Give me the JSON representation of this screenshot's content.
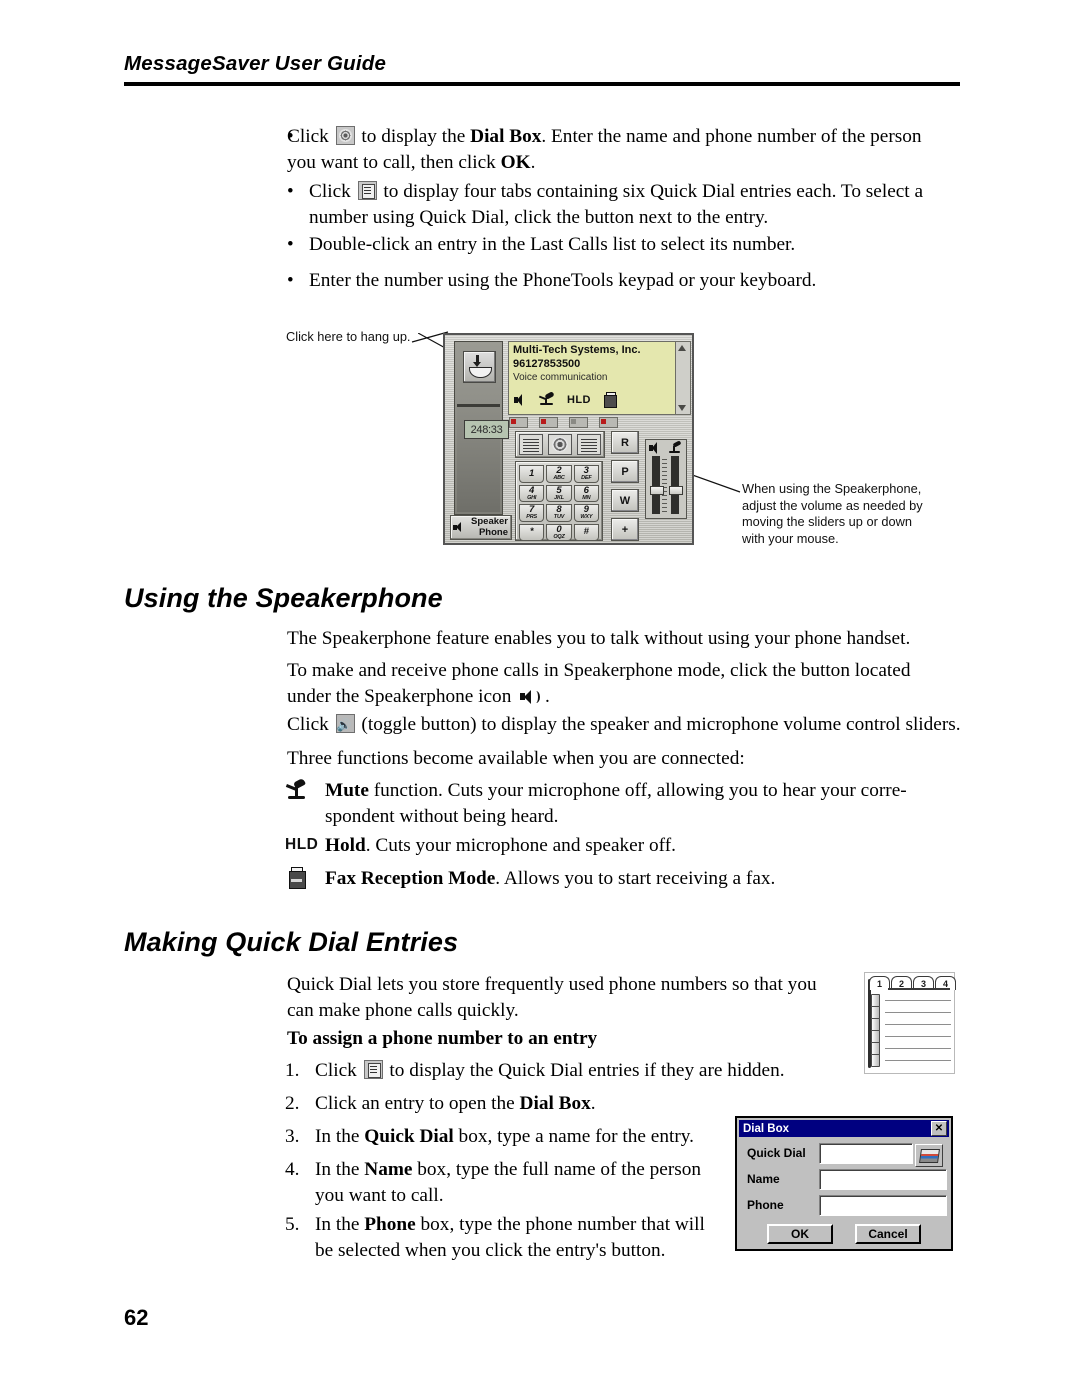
{
  "document": {
    "running_head": "MessageSaver User Guide",
    "page_number": "62"
  },
  "intro_bullets": [
    {
      "icon": "dial-box-icon",
      "segments": [
        {
          "t": "Click ",
          "b": false
        },
        {
          "t": "ICON",
          "b": false
        },
        {
          "t": " to display the ",
          "b": false
        },
        {
          "t": "Dial Box",
          "b": true
        },
        {
          "t": ". Enter the name and phone number of the person you want to call, then click ",
          "b": false
        },
        {
          "t": "OK",
          "b": true
        },
        {
          "t": ".",
          "b": false
        }
      ]
    },
    {
      "icon": "quick-dial-icon",
      "segments": [
        {
          "t": "Click ",
          "b": false
        },
        {
          "t": "ICON",
          "b": false
        },
        {
          "t": " to display four tabs containing six Quick Dial entries each. To select a number using Quick Dial, click the button next to the entry.",
          "b": false
        }
      ]
    },
    {
      "icon": "",
      "segments": [
        {
          "t": "Double-click an entry in the Last Calls list to select its number.",
          "b": false
        }
      ]
    },
    {
      "icon": "",
      "segments": [
        {
          "t": "Enter the number using the PhoneTools keypad or your keyboard.",
          "b": false
        }
      ]
    }
  ],
  "figure_dialer": {
    "callout_hangup": "Click here to hang up.",
    "callout_sliders": "When using the Speakerphone, adjust the volume as needed by moving the sliders up or down with your mouse.",
    "display": {
      "caller": "Multi-Tech Systems, Inc.",
      "number": "96127853500",
      "mode": "Voice communication",
      "status_icons": [
        "speaker-icon",
        "mute-icon",
        "hold-label",
        "fax-icon"
      ],
      "hold_label": "HLD"
    },
    "timer": "248:33",
    "speakerphone_button": {
      "line1": "Speaker",
      "line2": "Phone"
    },
    "keypad": [
      {
        "digit": "1",
        "letters": ""
      },
      {
        "digit": "2",
        "letters": "ABC"
      },
      {
        "digit": "3",
        "letters": "DEF"
      },
      {
        "digit": "4",
        "letters": "GHI"
      },
      {
        "digit": "5",
        "letters": "JKL"
      },
      {
        "digit": "6",
        "letters": "MN"
      },
      {
        "digit": "7",
        "letters": "PRS"
      },
      {
        "digit": "8",
        "letters": "TUV"
      },
      {
        "digit": "9",
        "letters": "WXY"
      },
      {
        "digit": "*",
        "letters": ""
      },
      {
        "digit": "0",
        "letters": "OQZ"
      },
      {
        "digit": "#",
        "letters": ""
      }
    ],
    "side_buttons": [
      "R",
      "P",
      "W",
      "+"
    ],
    "leds": [
      "on",
      "on",
      "off",
      "on"
    ]
  },
  "section_speakerphone": {
    "heading": "Using the Speakerphone",
    "p1": "The Speakerphone feature enables you to talk without using your phone handset.",
    "p2_a": "To make and receive phone calls in Speakerphone mode, click the button located under the Speakerphone icon ",
    "p2_b": " .",
    "p3_a": "Click ",
    "p3_b": " (toggle button) to display the speaker and microphone volume control sliders.",
    "p4": "Three functions become available when you are connected:",
    "functions": [
      {
        "icon": "mute-icon",
        "bold": "Mute",
        "rest": " function. Cuts your microphone off, allowing you to hear your corre-spondent without being heard."
      },
      {
        "icon": "hold-label",
        "icon_text": "HLD",
        "bold": "Hold",
        "rest": ". Cuts your microphone and speaker off."
      },
      {
        "icon": "fax-icon",
        "bold": "Fax Reception Mode",
        "rest": ". Allows you to start receiving a fax."
      }
    ]
  },
  "section_quickdial": {
    "heading": "Making Quick Dial Entries",
    "p1": "Quick Dial lets you store frequently used phone numbers so that you can make phone calls quickly.",
    "subhead": "To assign a phone number to an entry",
    "steps": [
      {
        "n": "1.",
        "pre": "Click ",
        "icon": "quick-dial-icon",
        "post": " to display the Quick Dial entries if they are hidden."
      },
      {
        "n": "2.",
        "pre": "Click an entry to open the ",
        "bold": "Dial Box",
        "post": "."
      },
      {
        "n": "3.",
        "pre": "In the ",
        "bold": "Quick Dial",
        "post": " box, type a name for the entry."
      },
      {
        "n": "4.",
        "pre": "In the ",
        "bold": "Name",
        "post": " box, type the full name of the person you want to call."
      },
      {
        "n": "5.",
        "pre": "In the ",
        "bold": "Phone",
        "post": " box, type the phone number that will be selected when you click the entry's button."
      }
    ],
    "quick_dial_tabs": [
      "1",
      "2",
      "3",
      "4"
    ],
    "quick_dial_row_count": 6
  },
  "dialog_dial_box": {
    "title": "Dial Box",
    "close_label": "✕",
    "fields": [
      {
        "label": "Quick Dial",
        "value": "",
        "placeholder": ""
      },
      {
        "label": "Name",
        "value": "",
        "placeholder": ""
      },
      {
        "label": "Phone",
        "value": "",
        "placeholder": ""
      }
    ],
    "phonebook_icon": "phonebook-icon",
    "ok_label": "OK",
    "cancel_label": "Cancel"
  },
  "colors": {
    "dialog_titlebar": "#000080",
    "dialog_face": "#c0c0c0",
    "dialer_lcd": "#e4e7ae",
    "led_on": "#b81b1b"
  }
}
